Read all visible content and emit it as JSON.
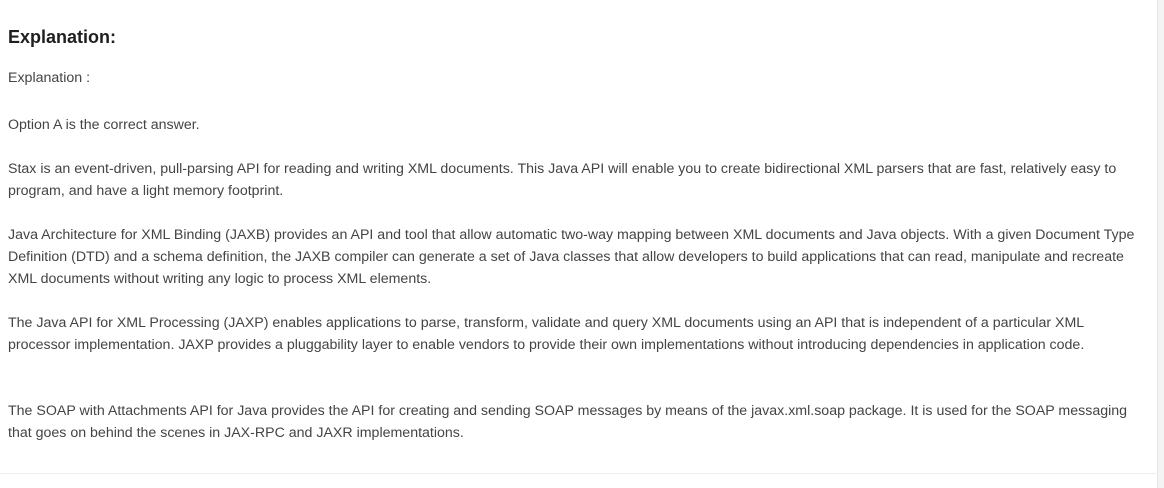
{
  "explanation": {
    "heading": "Explanation:",
    "label": "Explanation :",
    "paragraphs": [
      "Option A is the correct answer.",
      "Stax is an event-driven, pull-parsing API for reading and writing XML documents. This Java API will enable you to create bidirectional XML parsers that are fast, relatively easy to program, and have a light memory footprint.",
      "Java Architecture for XML Binding (JAXB) provides an API and tool that allow automatic two-way mapping between XML documents and Java objects. With a given Document Type Definition (DTD) and a schema definition, the JAXB compiler can generate a set of Java classes that allow developers to build applications that can read, manipulate and recreate XML documents without writing any logic to process XML elements.",
      "The Java API for XML Processing (JAXP) enables applications to parse, transform, validate and query XML documents using an API that is independent of a particular XML processor implementation. JAXP provides a pluggability layer to enable vendors to provide their own implementations without introducing dependencies in application code.",
      "The SOAP with Attachments API for Java provides the API for creating and sending SOAP messages by means of the javax.xml.soap package. It is used for the SOAP messaging that goes on behind the scenes in JAX-RPC and JAXR implementations."
    ]
  }
}
